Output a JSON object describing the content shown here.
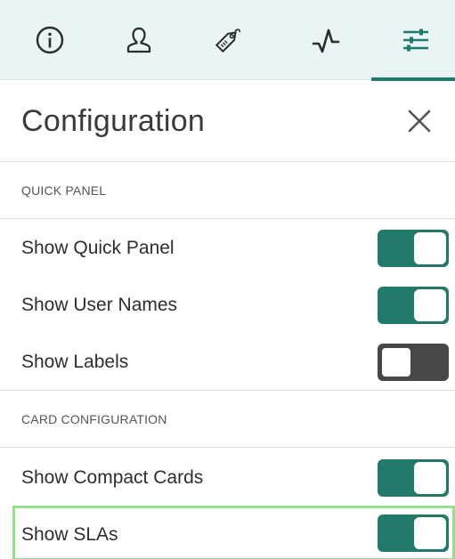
{
  "tabs": [
    {
      "icon": "info-icon",
      "active": false
    },
    {
      "icon": "user-icon",
      "active": false
    },
    {
      "icon": "tag-icon",
      "active": false
    },
    {
      "icon": "activity-icon",
      "active": false
    },
    {
      "icon": "sliders-icon",
      "active": true
    }
  ],
  "header": {
    "title": "Configuration",
    "close_icon": "close-icon"
  },
  "sections": [
    {
      "title": "QUICK PANEL",
      "items": [
        {
          "label": "Show Quick Panel",
          "enabled": true
        },
        {
          "label": "Show User Names",
          "enabled": true
        },
        {
          "label": "Show Labels",
          "enabled": false
        }
      ]
    },
    {
      "title": "CARD CONFIGURATION",
      "items": [
        {
          "label": "Show Compact Cards",
          "enabled": true
        },
        {
          "label": "Show SLAs",
          "enabled": true
        }
      ]
    }
  ],
  "colors": {
    "accent": "#237a6c",
    "toggle_off": "#474747",
    "tabbar_bg": "#eaf4f5",
    "highlight": "#8fe38a"
  }
}
